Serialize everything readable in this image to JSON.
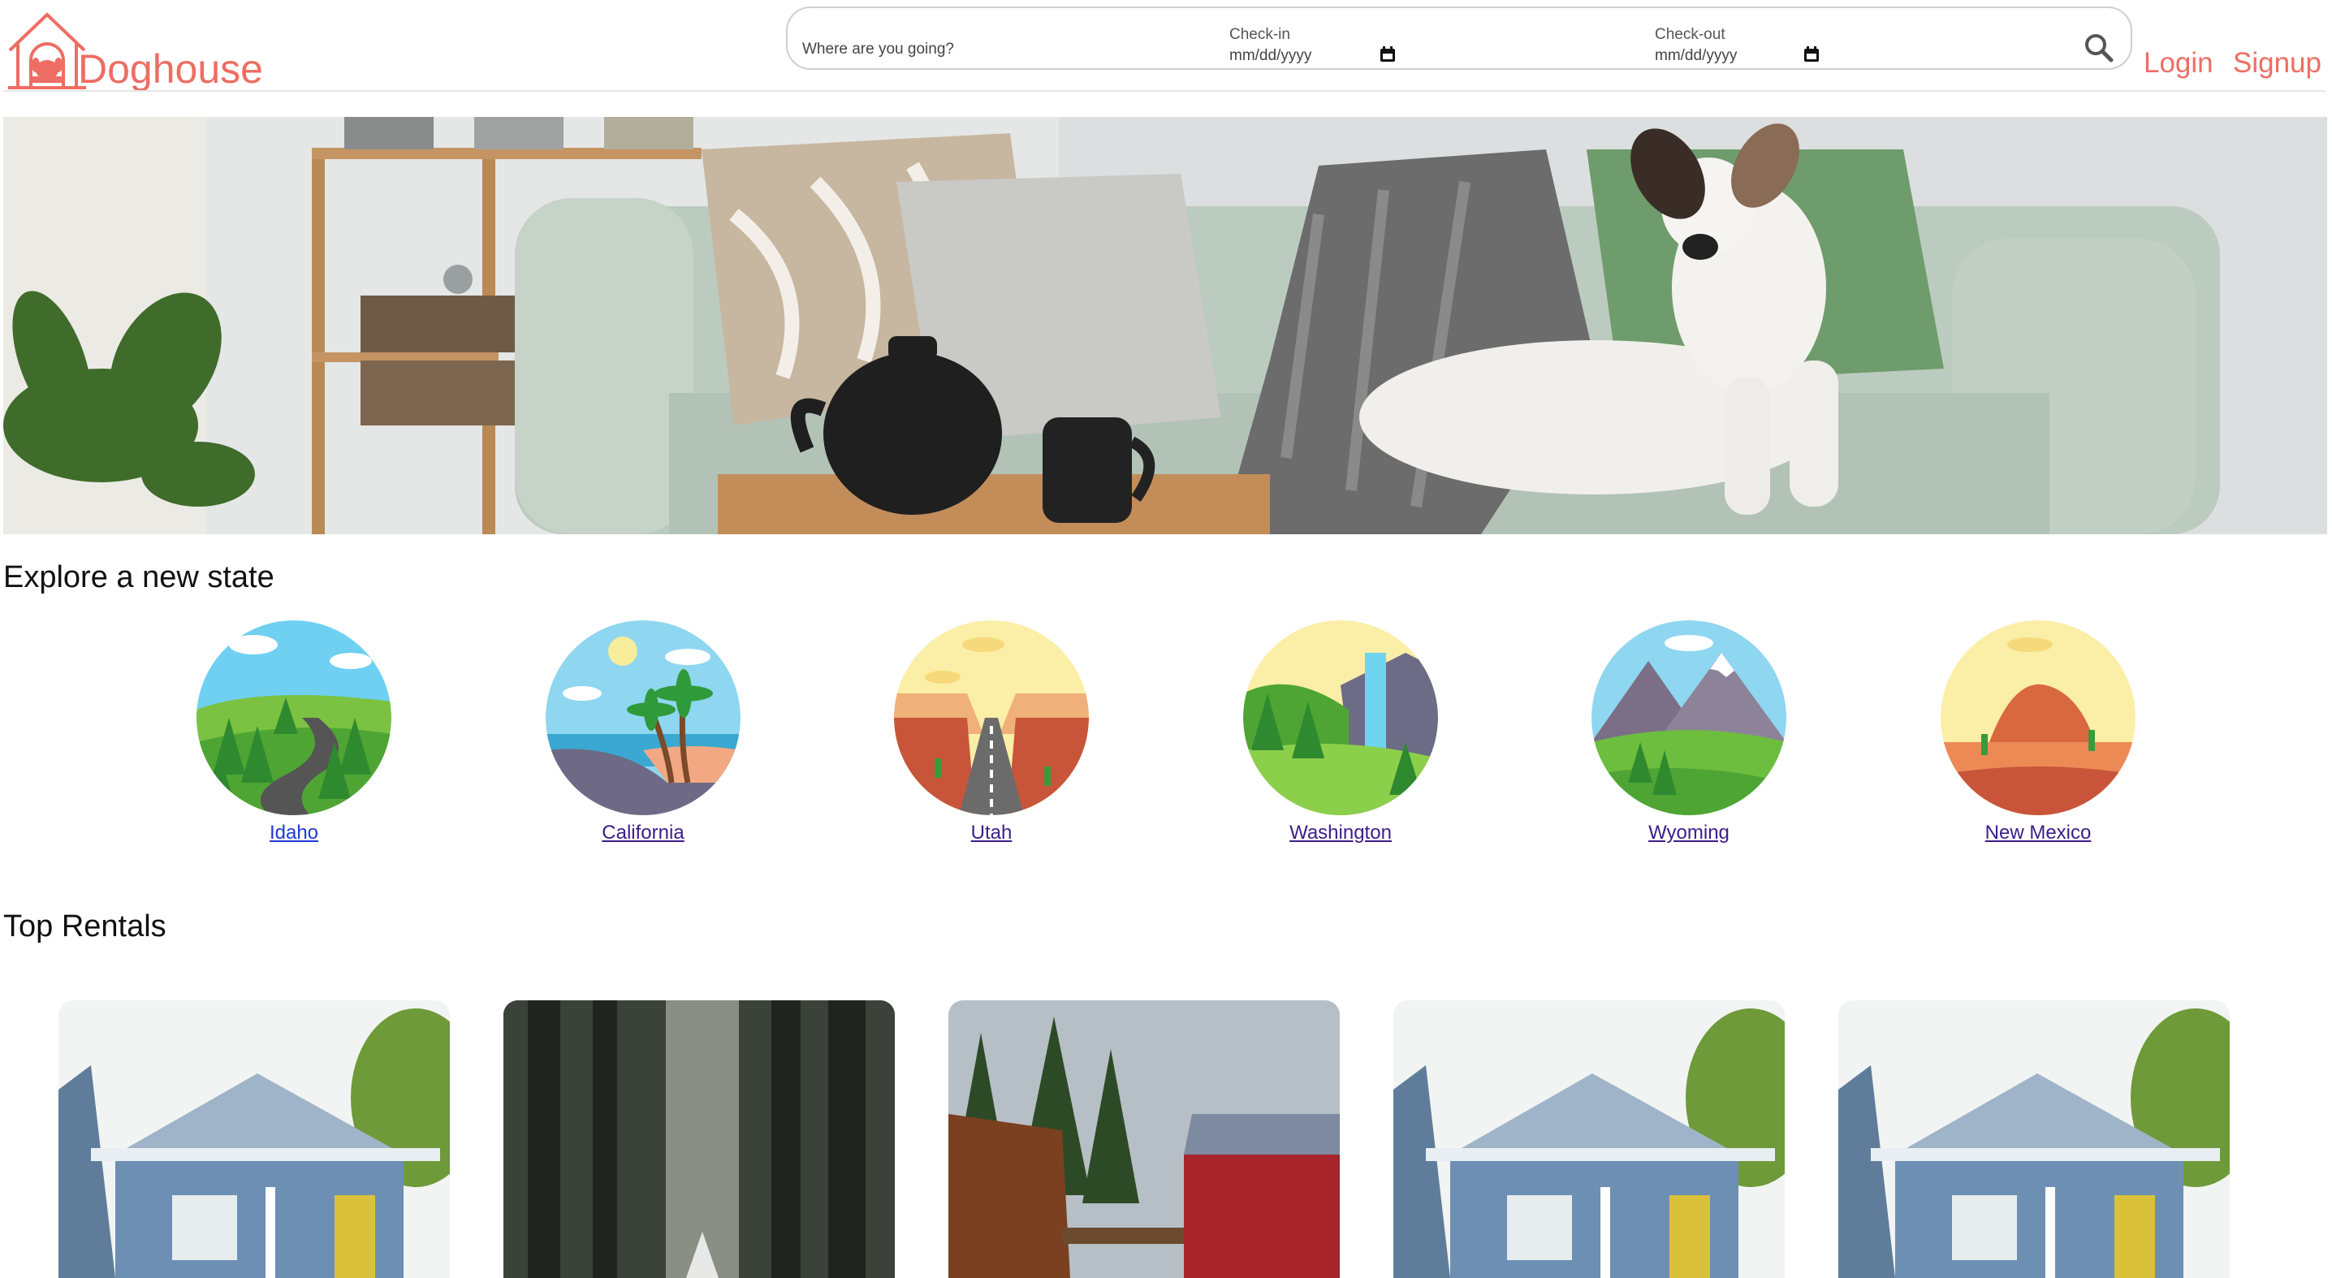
{
  "brand": {
    "name": "Doghouse",
    "color": "#ee6d63"
  },
  "search": {
    "where_placeholder": "Where are you going?",
    "checkin_label": "Check-in",
    "checkin_value": "mm/dd/yyyy",
    "checkout_label": "Check-out",
    "checkout_value": "mm/dd/yyyy",
    "search_icon": "search-icon"
  },
  "nav": {
    "login": "Login",
    "signup": "Signup"
  },
  "hero": {
    "image": "dog-on-sofa-photo"
  },
  "explore": {
    "title": "Explore a new state",
    "states": [
      {
        "label": "Idaho",
        "icon": "forest-road-illustration"
      },
      {
        "label": "California",
        "icon": "beach-palm-illustration"
      },
      {
        "label": "Utah",
        "icon": "desert-road-illustration"
      },
      {
        "label": "Washington",
        "icon": "waterfall-illustration"
      },
      {
        "label": "Wyoming",
        "icon": "mountains-illustration"
      },
      {
        "label": "New Mexico",
        "icon": "mesa-illustration"
      }
    ]
  },
  "rentals": {
    "title": "Top Rentals",
    "items": [
      {
        "image": "blue-house-photo"
      },
      {
        "image": "forest-cabin-photo"
      },
      {
        "image": "red-barn-photo"
      },
      {
        "image": "blue-house-photo"
      },
      {
        "image": "blue-house-photo"
      }
    ]
  }
}
